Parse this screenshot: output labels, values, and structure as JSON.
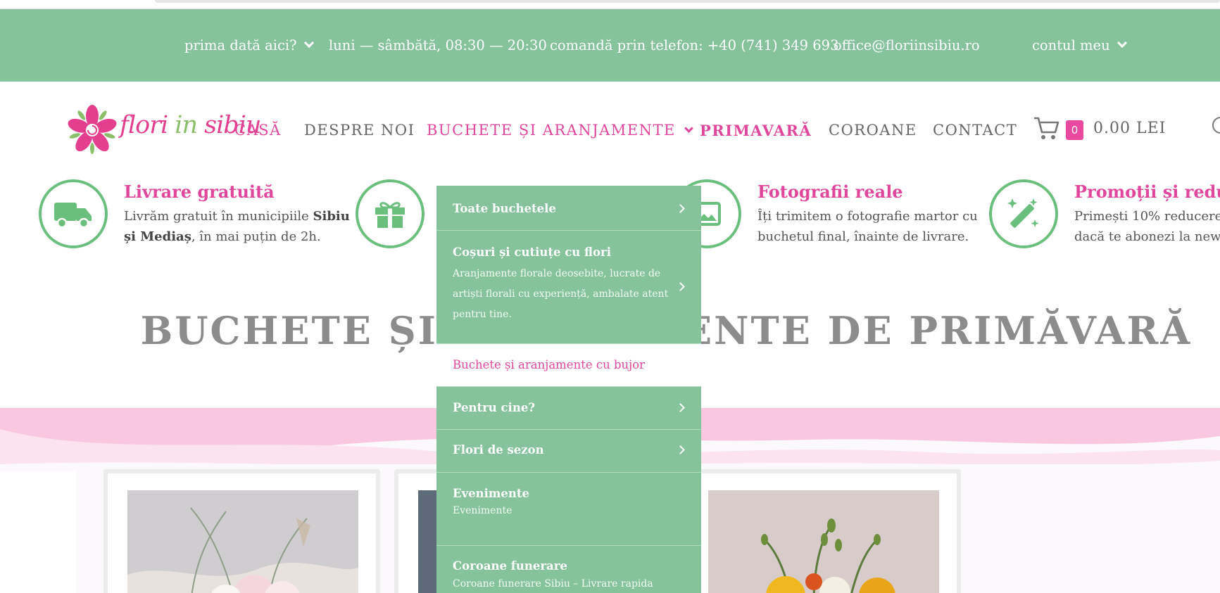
{
  "topbar": {
    "first_time": "prima dată aici?",
    "hours": "luni — sâmbătă, 08:30 — 20:30",
    "phone": "comandă prin telefon: +40 (741) 349 693",
    "email": "office@floriinsibiu.ro",
    "account": "contul meu"
  },
  "logo": {
    "part1": "flori ",
    "part2": "in ",
    "part3": "sibiu"
  },
  "nav": {
    "home": "CASĂ",
    "about": "DESPRE NOI",
    "bouquets": "BUCHETE ȘI ARANJAMENTE",
    "spring": "PRIMAVARĂ",
    "wreaths": "COROANE",
    "contact": "CONTACT"
  },
  "cart": {
    "count": "0",
    "total": "0.00 LEI"
  },
  "features": [
    {
      "title": "Livrare gratuită",
      "line1": "Livrăm gratuit în municipiile ",
      "line1_bold": "Sibiu",
      "line2_bold": "și Mediaș",
      "line2": ", în mai puțin de 2h.",
      "icon": "truck-icon"
    },
    {
      "title": "",
      "icon": "gift-icon"
    },
    {
      "title": "Fotografii reale",
      "line1": "Îți trimitem o fotografie martor cu",
      "line2": "buchetul final, înainte de livrare.",
      "icon": "image-icon"
    },
    {
      "title": "Promoții și reduc",
      "line1": "Primești 10% reducere p",
      "line2": "dacă te abonezi la news",
      "icon": "magic-wand-icon"
    }
  ],
  "headline": "BUCHETE ȘI ARANJAMENTE DE PRIMĂVARĂ",
  "dropdown": [
    {
      "title": "Toate buchetele",
      "desc": "",
      "arrow": true
    },
    {
      "title": "Coșuri și cutiuțe cu flori",
      "desc": "Aranjamente florale deosebite, lucrate de artiști florali cu experiență, ambalate atent pentru tine.",
      "arrow": true
    },
    {
      "title": "Buchete și aranjamente cu bujor",
      "desc": "",
      "arrow": false
    },
    {
      "title": "Pentru cine?",
      "desc": "",
      "arrow": true
    },
    {
      "title": "Flori de sezon",
      "desc": "",
      "arrow": true
    },
    {
      "title": "Evenimente",
      "desc": "Evenimente",
      "arrow": false
    },
    {
      "title": "Coroane funerare",
      "desc": "Coroane funerare Sibiu – Livrare rapida",
      "arrow": false
    }
  ],
  "colors": {
    "green": "#86c29c",
    "pink": "#e0479c",
    "icon_green": "#6abf7d"
  }
}
